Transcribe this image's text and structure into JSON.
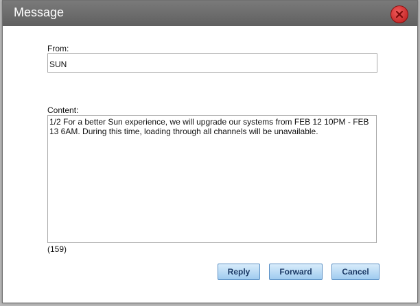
{
  "window": {
    "title": "Message"
  },
  "from": {
    "label": "From:",
    "value": "SUN"
  },
  "content": {
    "label": "Content:",
    "value": "1/2 For a better Sun experience, we will upgrade our systems from FEB 12 10PM - FEB 13 6AM. During this time, loading through all channels will be unavailable.",
    "char_count": "(159)"
  },
  "buttons": {
    "reply": "Reply",
    "forward": "Forward",
    "cancel": "Cancel"
  },
  "icons": {
    "close": "close-icon"
  },
  "colors": {
    "titlebar": "#6a6a6a",
    "close_button": "#d42a2a",
    "button_fill": "#b9dcf6",
    "button_text": "#1c3a66"
  }
}
